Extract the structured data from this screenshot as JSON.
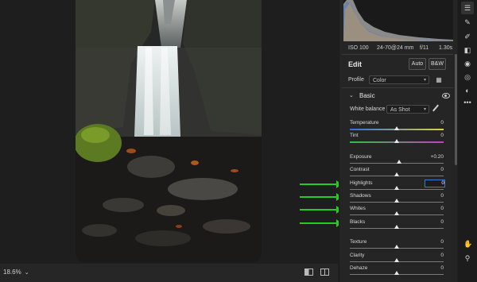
{
  "photo": {},
  "bottom_bar": {
    "zoom": "18.6%"
  },
  "camera_info": {
    "iso": "ISO 100",
    "lens": "24-70@24 mm",
    "aperture": "f/11",
    "shutter": "1.30s"
  },
  "edit": {
    "title": "Edit",
    "auto_label": "Auto",
    "bw_label": "B&W",
    "profile_label": "Profile",
    "profile_value": "Color"
  },
  "basic": {
    "title": "Basic",
    "white_balance_label": "White balance",
    "white_balance_value": "As Shot",
    "sliders": {
      "temperature": {
        "label": "Temperature",
        "value": "0"
      },
      "tint": {
        "label": "Tint",
        "value": "0"
      },
      "exposure": {
        "label": "Exposure",
        "value": "+0.20"
      },
      "contrast": {
        "label": "Contrast",
        "value": "0"
      },
      "highlights": {
        "label": "Highlights",
        "value": "0"
      },
      "shadows": {
        "label": "Shadows",
        "value": "0"
      },
      "whites": {
        "label": "Whites",
        "value": "0"
      },
      "blacks": {
        "label": "Blacks",
        "value": "0"
      },
      "texture": {
        "label": "Texture",
        "value": "0"
      },
      "clarity": {
        "label": "Clarity",
        "value": "0"
      },
      "dehaze": {
        "label": "Dehaze",
        "value": "0"
      }
    }
  },
  "tool_rail_icons": [
    "sliders-icon",
    "healing-brush-icon",
    "brush-icon",
    "gradient-icon",
    "circle-icon",
    "redeye-icon",
    "presets-icon",
    "more-icon",
    "hand-icon",
    "zoom-icon"
  ],
  "colors": {
    "accent": "#3a78d6",
    "arrow": "#22cc22",
    "panel": "#252525"
  }
}
